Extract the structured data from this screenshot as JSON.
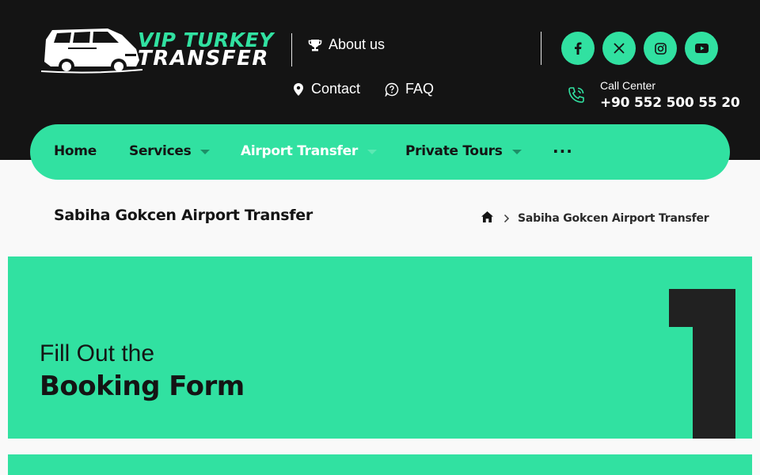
{
  "header": {
    "logo": {
      "line1": "VIP TURKEY",
      "line2": "TRANSFER"
    },
    "links": [
      {
        "label": "About us",
        "icon": "trophy-icon"
      },
      {
        "label": "Contact",
        "icon": "map-pin-icon"
      },
      {
        "label": "FAQ",
        "icon": "question-bubble-icon"
      }
    ],
    "social": [
      "facebook-icon",
      "x-icon",
      "instagram-icon",
      "youtube-icon"
    ],
    "call_center": {
      "label": "Call Center",
      "number": "+90 552 500 55 20",
      "icon": "phone-icon"
    }
  },
  "nav": {
    "items": [
      {
        "label": "Home",
        "has_dropdown": false,
        "active": false
      },
      {
        "label": "Services",
        "has_dropdown": true,
        "active": false
      },
      {
        "label": "Airport Transfer",
        "has_dropdown": true,
        "active": true
      },
      {
        "label": "Private Tours",
        "has_dropdown": true,
        "active": false
      }
    ],
    "more": "···"
  },
  "page": {
    "title": "Sabiha Gokcen Airport Transfer",
    "breadcrumb": {
      "current": "Sabiha Gokcen Airport Transfer",
      "home_icon": "home-icon",
      "separator_icon": "chevron-right-icon"
    }
  },
  "steps": [
    {
      "number": "1",
      "subtitle": "Fill Out the",
      "title": "Booking Form"
    }
  ],
  "colors": {
    "accent": "#31e1a1",
    "dark": "#141414",
    "page_bg": "#f9f9f9"
  }
}
